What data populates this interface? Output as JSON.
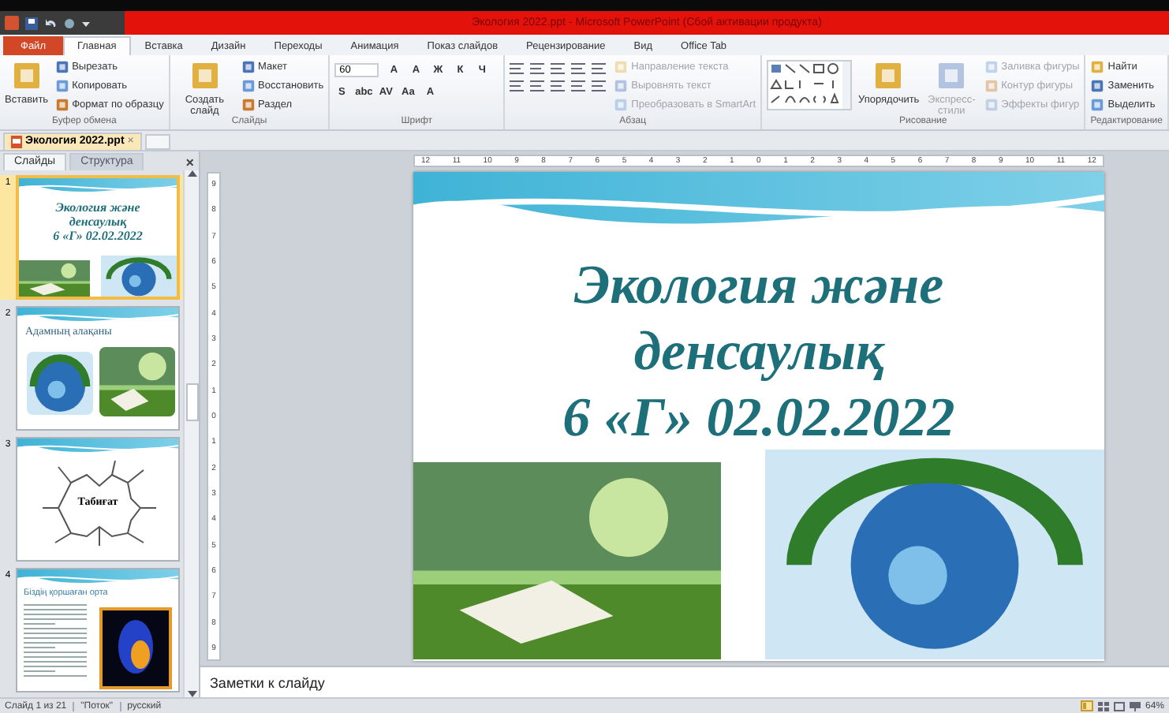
{
  "window": {
    "title": "Экология 2022.ppt - Microsoft PowerPoint (Сбой активации продукта)"
  },
  "ribbon_tabs": [
    {
      "label": "Файл",
      "kind": "file",
      "selected": false
    },
    {
      "label": "Главная",
      "kind": "tab",
      "selected": true
    },
    {
      "label": "Вставка",
      "kind": "tab",
      "selected": false
    },
    {
      "label": "Дизайн",
      "kind": "tab",
      "selected": false
    },
    {
      "label": "Переходы",
      "kind": "tab",
      "selected": false
    },
    {
      "label": "Анимация",
      "kind": "tab",
      "selected": false
    },
    {
      "label": "Показ слайдов",
      "kind": "tab",
      "selected": false
    },
    {
      "label": "Рецензирование",
      "kind": "tab",
      "selected": false
    },
    {
      "label": "Вид",
      "kind": "tab",
      "selected": false
    },
    {
      "label": "Office Tab",
      "kind": "tab",
      "selected": false
    }
  ],
  "ribbon_groups": [
    {
      "title": "Буфер обмена",
      "kind": "clipboard",
      "items": [
        {
          "kind": "large",
          "label": "Вставить",
          "disabled": false
        },
        {
          "kind": "small",
          "label": "Вырезать",
          "disabled": false
        },
        {
          "kind": "small",
          "label": "Копировать",
          "disabled": false
        },
        {
          "kind": "small",
          "label": "Формат по образцу",
          "disabled": false
        }
      ]
    },
    {
      "title": "Слайды",
      "kind": "slides",
      "items": [
        {
          "kind": "large",
          "label": "Создать слайд",
          "disabled": false
        },
        {
          "kind": "small",
          "label": "Макет",
          "disabled": false
        },
        {
          "kind": "small",
          "label": "Восстановить",
          "disabled": false
        },
        {
          "kind": "small",
          "label": "Раздел",
          "disabled": false
        }
      ]
    },
    {
      "title": "Шрифт",
      "kind": "font",
      "items": [
        {
          "kind": "field",
          "label": "60",
          "disabled": false
        },
        {
          "kind": "glyph",
          "label": "A",
          "disabled": false
        },
        {
          "kind": "glyph",
          "label": "A",
          "disabled": false
        },
        {
          "kind": "glyph",
          "label": "Ж",
          "disabled": false
        },
        {
          "kind": "glyph",
          "label": "К",
          "disabled": false
        },
        {
          "kind": "glyph",
          "label": "Ч",
          "disabled": false
        },
        {
          "kind": "glyph",
          "label": "S",
          "disabled": false
        },
        {
          "kind": "glyph",
          "label": "abc",
          "disabled": false
        },
        {
          "kind": "glyph",
          "label": "AV",
          "disabled": false
        },
        {
          "kind": "glyph",
          "label": "Aa",
          "disabled": false
        },
        {
          "kind": "glyph",
          "label": "A",
          "disabled": false
        }
      ]
    },
    {
      "title": "Абзац",
      "kind": "paragraph",
      "items": [
        {
          "kind": "small",
          "label": "Направление текста",
          "disabled": true
        },
        {
          "kind": "small",
          "label": "Выровнять текст",
          "disabled": true
        },
        {
          "kind": "small",
          "label": "Преобразовать в SmartArt",
          "disabled": true
        }
      ]
    },
    {
      "title": "Рисование",
      "kind": "drawing",
      "items": [
        {
          "kind": "large",
          "label": "Упорядочить",
          "disabled": false
        },
        {
          "kind": "large",
          "label": "Экспресс-стили",
          "disabled": true
        },
        {
          "kind": "small",
          "label": "Заливка фигуры",
          "disabled": true
        },
        {
          "kind": "small",
          "label": "Контур фигуры",
          "disabled": true
        },
        {
          "kind": "small",
          "label": "Эффекты фигур",
          "disabled": true
        }
      ]
    },
    {
      "title": "Редактирование",
      "kind": "editing",
      "items": [
        {
          "kind": "small",
          "label": "Найти",
          "disabled": false
        },
        {
          "kind": "small",
          "label": "Заменить",
          "disabled": false
        },
        {
          "kind": "small",
          "label": "Выделить",
          "disabled": false
        }
      ]
    }
  ],
  "document_tabs": [
    {
      "label": "Экология 2022.ppt",
      "close_glyph": "×",
      "selected": true
    }
  ],
  "side_panel": {
    "tabs": [
      {
        "label": "Слайды",
        "selected": true
      },
      {
        "label": "Структура",
        "selected": false
      }
    ],
    "close_glyph": "×",
    "thumbnails": [
      {
        "number": "1",
        "kind": "title",
        "selected": true,
        "title_lines": [
          "Экология және",
          "денсаулық",
          "6 «Г» 02.02.2022"
        ]
      },
      {
        "number": "2",
        "kind": "photos",
        "selected": false,
        "title_lines": [
          "Адамның алақаны"
        ]
      },
      {
        "number": "3",
        "kind": "diagram",
        "selected": false,
        "title_lines": [
          "Табиғат"
        ]
      },
      {
        "number": "4",
        "kind": "text_image",
        "selected": false,
        "title_lines": [
          "Біздің қоршаған орта"
        ]
      }
    ]
  },
  "rulers": {
    "horizontal": [
      "12",
      "11",
      "10",
      "9",
      "8",
      "7",
      "6",
      "5",
      "4",
      "3",
      "2",
      "1",
      "0",
      "1",
      "2",
      "3",
      "4",
      "5",
      "6",
      "7",
      "8",
      "9",
      "10",
      "11",
      "12"
    ],
    "vertical": [
      "9",
      "8",
      "7",
      "6",
      "5",
      "4",
      "3",
      "2",
      "1",
      "0",
      "1",
      "2",
      "3",
      "4",
      "5",
      "6",
      "7",
      "8",
      "9"
    ]
  },
  "slide": {
    "title_lines": [
      "Экология және",
      "денсаулық",
      "6 «Г» 02.02.2022"
    ]
  },
  "notes": {
    "placeholder": "Заметки к слайду"
  },
  "status_bar": {
    "slide": "Слайд 1 из 21",
    "theme": "\"Поток\"",
    "language": "русский",
    "zoom": "64%"
  }
}
